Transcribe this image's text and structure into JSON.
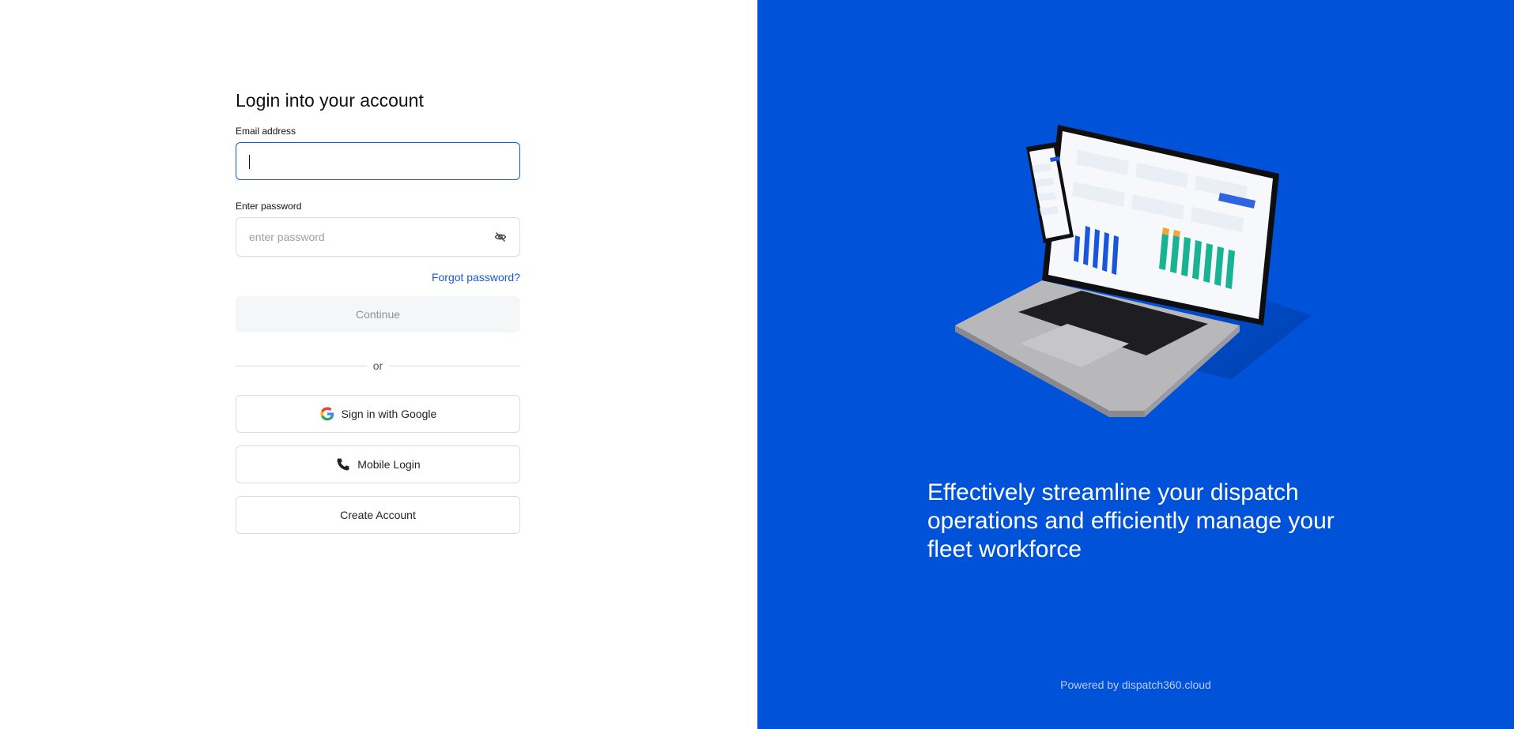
{
  "login": {
    "title": "Login into your account",
    "email_label": "Email address",
    "email_value": "",
    "password_label": "Enter password",
    "password_placeholder": "enter password",
    "forgot_password": "Forgot password?",
    "continue_label": "Continue",
    "divider_text": "or",
    "google_label": "Sign in with Google",
    "mobile_label": "Mobile Login",
    "create_account_label": "Create Account"
  },
  "promo": {
    "tagline": "Effectively streamline your dispatch operations and efficiently manage your fleet workforce",
    "powered_by": "Powered by dispatch360.cloud",
    "illustration": "laptop-and-phone-dashboard"
  },
  "colors": {
    "primary": "#0052d9",
    "link": "#1a56db",
    "input_border": "#d9dce1",
    "focus_border": "#1a56db"
  }
}
